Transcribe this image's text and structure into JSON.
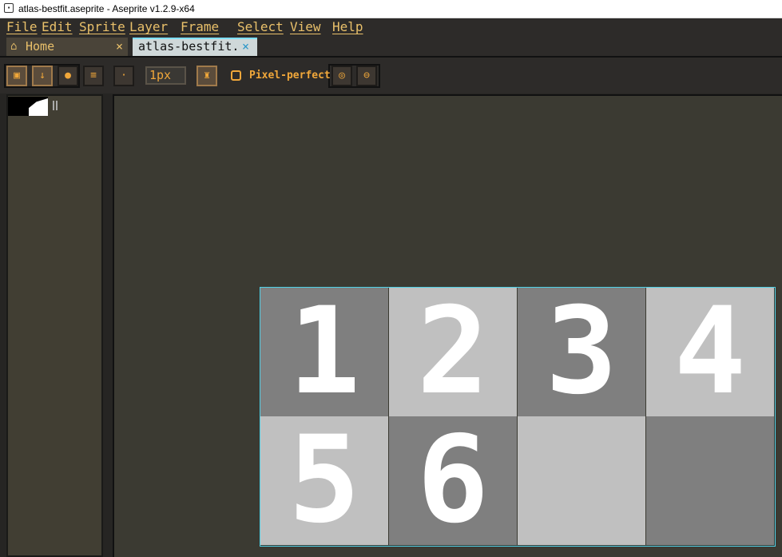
{
  "window": {
    "title": "atlas-bestfit.aseprite - Aseprite v1.2.9-x64"
  },
  "menu": [
    "File",
    "Edit",
    "Sprite",
    "Layer",
    "Frame",
    "Select",
    "View",
    "Help"
  ],
  "tabs": {
    "home": {
      "label": "Home",
      "close": "×"
    },
    "file": {
      "label": "atlas-bestfit.ase",
      "close": "×"
    }
  },
  "toolbar": {
    "brush_size": "1px",
    "pixel_perfect_label": "Pixel-perfect"
  },
  "sprite_cells": [
    "1",
    "2",
    "3",
    "4",
    "5",
    "6",
    "",
    ""
  ],
  "colors": {
    "accent": "#e9c06a",
    "selection_border": "#4fd0e6",
    "cell_dark": "#7f7f7f",
    "cell_light": "#c0c0c0",
    "canvas_bg": "#3b3a32"
  }
}
